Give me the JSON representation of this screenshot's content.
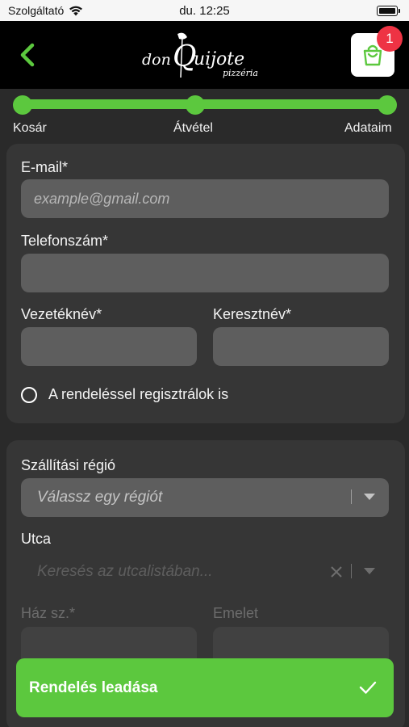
{
  "status_bar": {
    "carrier": "Szolgáltató",
    "time": "du. 12:25"
  },
  "header": {
    "logo_text": "donQuijote",
    "logo_subtext": "pizzéria",
    "cart_count": "1"
  },
  "progress": {
    "steps": [
      "Kosár",
      "Átvétel",
      "Adataim"
    ],
    "active_step": 3
  },
  "contact": {
    "email_label": "E-mail*",
    "email_placeholder": "example@gmail.com",
    "phone_label": "Telefonszám*",
    "lastname_label": "Vezetéknév*",
    "firstname_label": "Keresztnév*",
    "register_label": "A rendeléssel regisztrálok is"
  },
  "delivery": {
    "region_label": "Szállítási régió",
    "region_placeholder": "Válassz egy régiót",
    "street_label": "Utca",
    "street_placeholder": "Keresés az utcalistában...",
    "house_label": "Ház sz.*",
    "floor_label": "Emelet"
  },
  "order_button": {
    "label": "Rendelés leadása"
  },
  "colors": {
    "accent": "#5cc83e",
    "badge": "#ee3344",
    "background": "#2a2a2a",
    "card": "#363636",
    "input": "#5e5e5e"
  }
}
